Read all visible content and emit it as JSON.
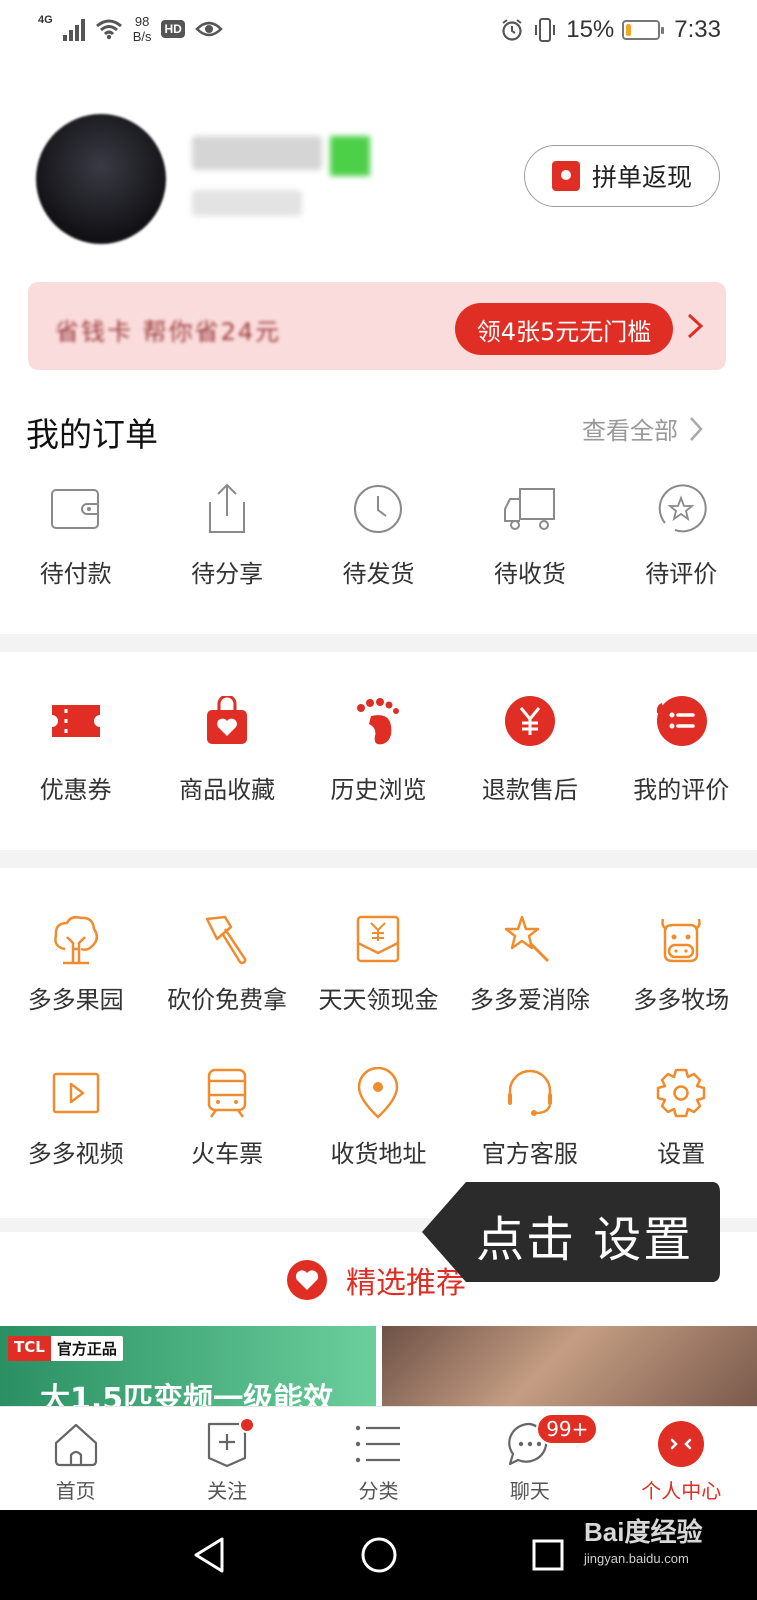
{
  "status_bar": {
    "network": "4G",
    "speed_value": "98",
    "speed_unit": "B/s",
    "hd": "HD",
    "battery_percent_text": "15%",
    "battery_level": 0.15,
    "time": "7:33"
  },
  "profile": {
    "pin_button_label": "拼单返现"
  },
  "savings_banner": {
    "blurred_text": "省钱卡 帮你省24元",
    "coupon_button_label": "领4张5元无门槛"
  },
  "orders": {
    "title": "我的订单",
    "view_all": "查看全部",
    "items": [
      {
        "label": "待付款",
        "icon": "wallet-icon"
      },
      {
        "label": "待分享",
        "icon": "share-icon"
      },
      {
        "label": "待发货",
        "icon": "clock-icon"
      },
      {
        "label": "待收货",
        "icon": "truck-icon"
      },
      {
        "label": "待评价",
        "icon": "star-review-icon"
      }
    ]
  },
  "shortcuts": {
    "items": [
      {
        "label": "优惠券",
        "icon": "coupon-icon"
      },
      {
        "label": "商品收藏",
        "icon": "favorite-bag-icon"
      },
      {
        "label": "历史浏览",
        "icon": "footprint-icon"
      },
      {
        "label": "退款售后",
        "icon": "refund-icon"
      },
      {
        "label": "我的评价",
        "icon": "my-review-icon"
      }
    ]
  },
  "services": {
    "row1": [
      {
        "label": "多多果园",
        "icon": "tree-icon"
      },
      {
        "label": "砍价免费拿",
        "icon": "axe-icon"
      },
      {
        "label": "天天领现金",
        "icon": "cash-envelope-icon"
      },
      {
        "label": "多多爱消除",
        "icon": "star-wand-icon"
      },
      {
        "label": "多多牧场",
        "icon": "cow-icon"
      }
    ],
    "row2": [
      {
        "label": "多多视频",
        "icon": "video-icon"
      },
      {
        "label": "火车票",
        "icon": "train-icon"
      },
      {
        "label": "收货地址",
        "icon": "location-icon"
      },
      {
        "label": "官方客服",
        "icon": "headset-icon"
      },
      {
        "label": "设置",
        "icon": "gear-icon"
      }
    ]
  },
  "tooltip": {
    "text": "点击 设置"
  },
  "recommend": {
    "title": "精选推荐"
  },
  "products": {
    "left_tag_brand": "TCL",
    "left_tag_label": "官方正品",
    "left_headline": "大1.5匹变频一级能效"
  },
  "tab_bar": {
    "tabs": [
      {
        "label": "首页",
        "icon": "home-icon"
      },
      {
        "label": "关注",
        "icon": "follow-icon"
      },
      {
        "label": "分类",
        "icon": "category-icon"
      },
      {
        "label": "聊天",
        "icon": "chat-icon"
      },
      {
        "label": "个人中心",
        "icon": "profile-icon"
      }
    ],
    "chat_badge": "99+"
  },
  "watermark": {
    "brand": "Bai度经验",
    "url": "jingyan.baidu.com"
  },
  "colors": {
    "brand_red": "#e02e24",
    "service_orange": "#f08c2e",
    "divider_gray": "#f3f3f3"
  }
}
